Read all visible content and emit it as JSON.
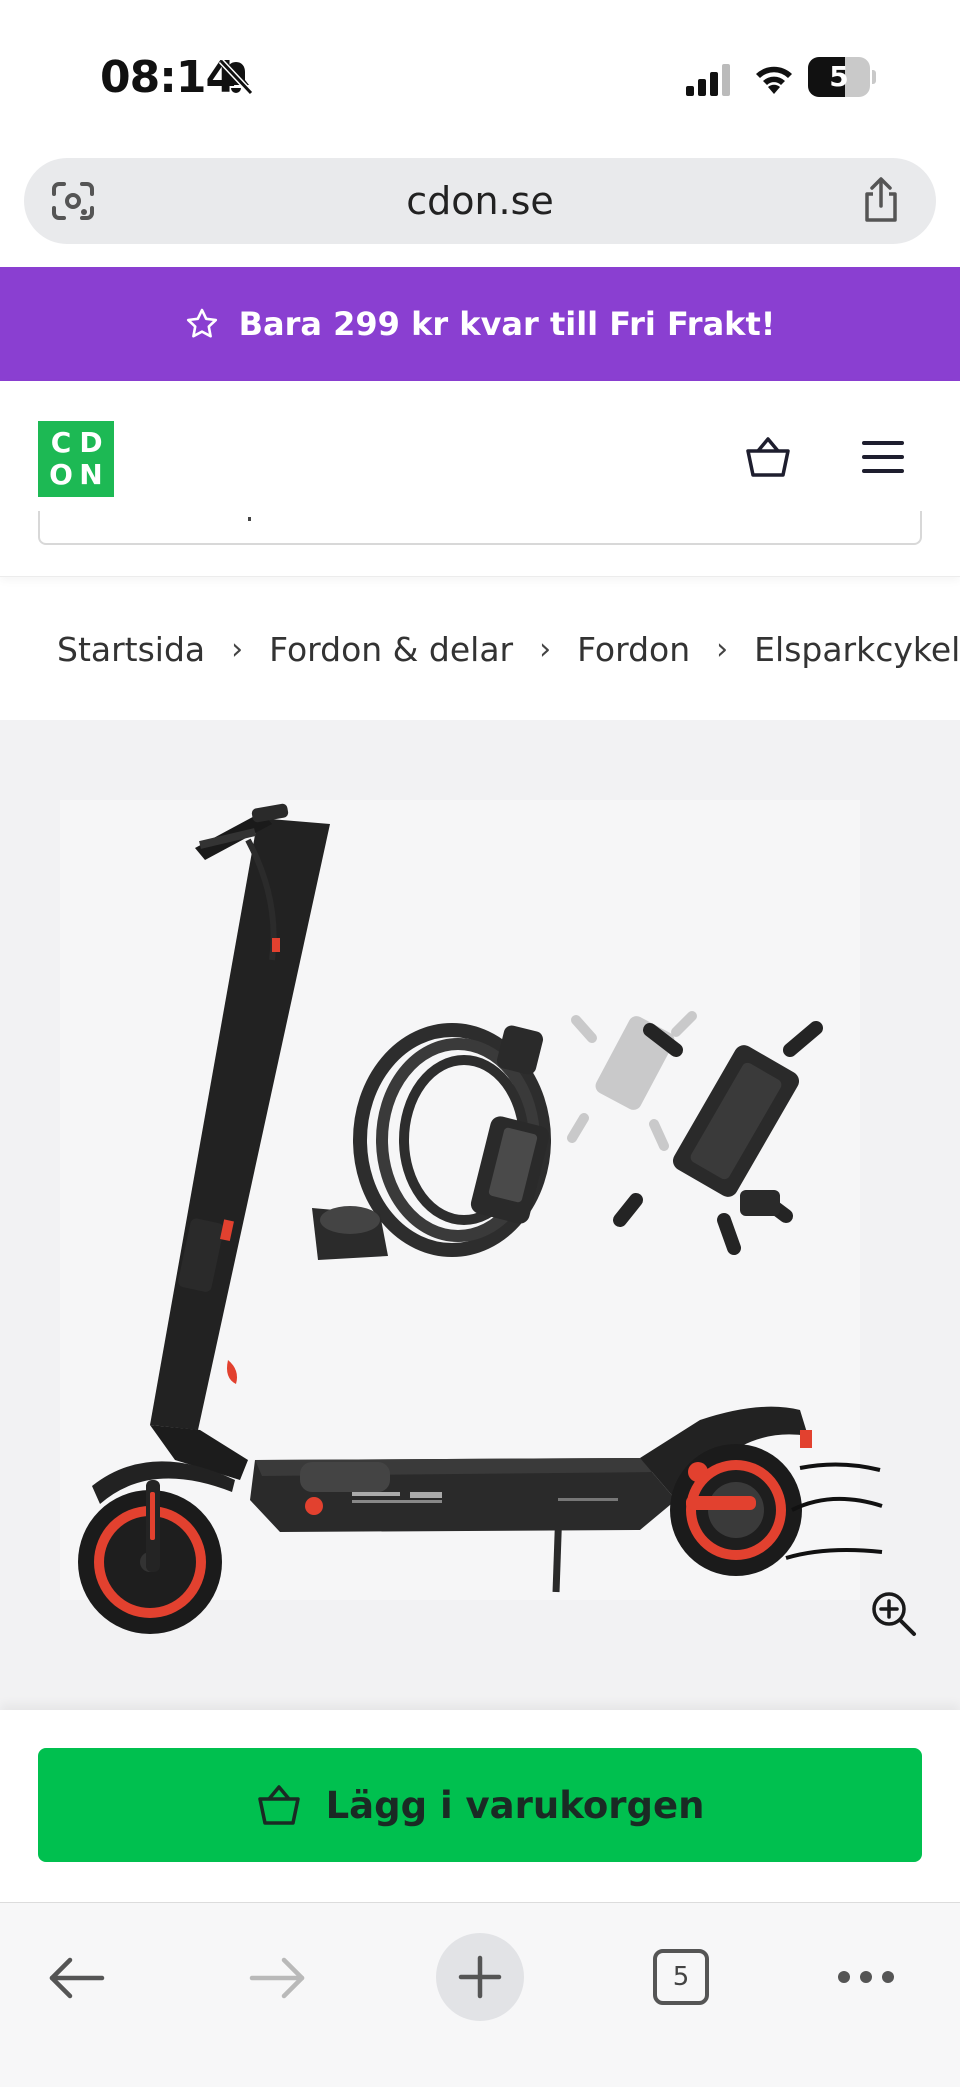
{
  "status_bar": {
    "time": "08:14",
    "battery_level": "5"
  },
  "browser": {
    "url": "cdon.se",
    "tab_count": "5"
  },
  "promo": {
    "text": "Bara 299 kr kvar till Fri Frakt!",
    "icon": "star-icon"
  },
  "header": {
    "logo_letters": [
      "C",
      "D",
      "O",
      "N"
    ],
    "brand_color": "#1db954",
    "icons": [
      "basket-icon",
      "menu-icon"
    ]
  },
  "breadcrumb": {
    "items": [
      "Startsida",
      "Fordon & delar",
      "Fordon",
      "Elsparkcykel"
    ]
  },
  "product": {
    "image_icon": "zoom-in-icon"
  },
  "cart": {
    "button_label": "Lägg i varukorgen",
    "button_color": "#00c04f"
  },
  "colors": {
    "promo_background": "#8a3fd1",
    "accent_red": "#e2412f"
  }
}
